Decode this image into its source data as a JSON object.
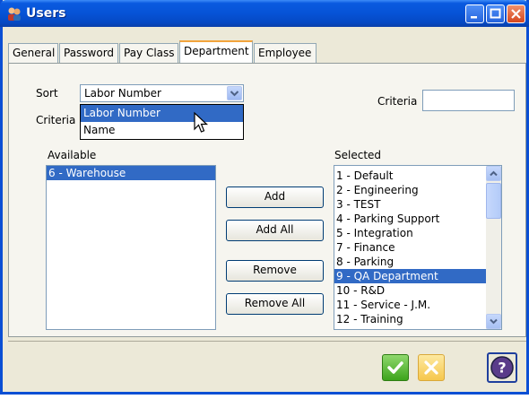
{
  "window": {
    "title": "Users"
  },
  "tabs": [
    "General",
    "Password",
    "Pay Class",
    "Department",
    "Employee"
  ],
  "active_tab": "Department",
  "sort": {
    "label": "Sort",
    "value": "Labor Number",
    "options": [
      "Labor Number",
      "Name"
    ],
    "highlighted": "Labor Number"
  },
  "criteria_left_label": "Criteria",
  "criteria_right": {
    "label": "Criteria",
    "value": ""
  },
  "available": {
    "label": "Available",
    "items": [
      "6 - Warehouse"
    ],
    "selected_index": 0
  },
  "selected": {
    "label": "Selected",
    "items": [
      "1 - Default",
      "2 - Engineering",
      "3 - TEST",
      "4 - Parking Support",
      "5 - Integration",
      "7 - Finance",
      "8 - Parking",
      "9 - QA Department",
      "10 - R&D",
      "11 - Service - J.M.",
      "12 - Training"
    ],
    "selected_index": 7
  },
  "buttons": {
    "add": "Add",
    "add_all": "Add All",
    "remove": "Remove",
    "remove_all": "Remove All"
  },
  "footer_icons": [
    "check-icon",
    "x-icon",
    "help-icon"
  ],
  "colors": {
    "titlebar": "#0653d6",
    "selection": "#316ac5",
    "ok": "#3da41c",
    "cancel": "#f6c74d"
  }
}
